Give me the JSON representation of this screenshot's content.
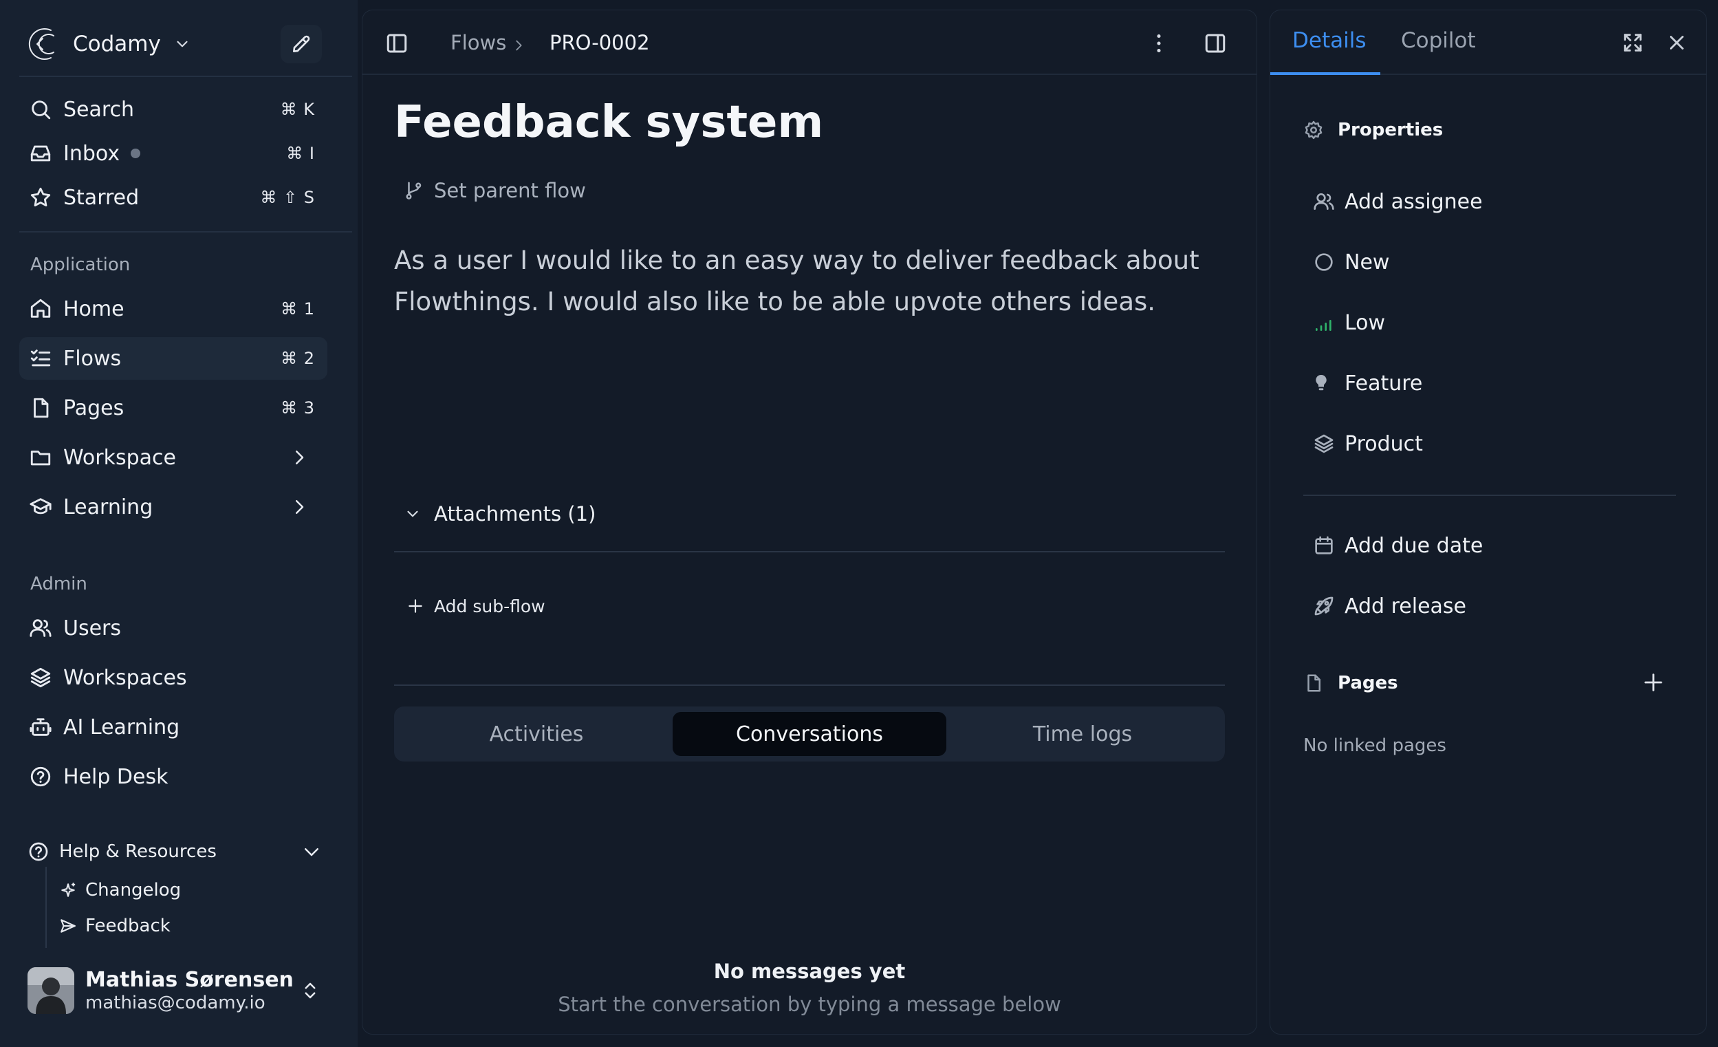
{
  "workspace": {
    "name": "Codamy"
  },
  "quick_nav": [
    {
      "label": "Search",
      "shortcut": "⌘ K",
      "icon": "search-icon"
    },
    {
      "label": "Inbox",
      "shortcut": "⌘ I",
      "icon": "inbox-icon"
    },
    {
      "label": "Starred",
      "shortcut": "⌘ ⇧ S",
      "icon": "star-icon"
    }
  ],
  "application": {
    "heading": "Application",
    "items": [
      {
        "label": "Home",
        "shortcut": "⌘ 1",
        "icon": "home-icon"
      },
      {
        "label": "Flows",
        "shortcut": "⌘ 2",
        "icon": "list-checks-icon",
        "active": true
      },
      {
        "label": "Pages",
        "shortcut": "⌘ 3",
        "icon": "file-icon"
      },
      {
        "label": "Workspace",
        "icon": "folder-icon"
      },
      {
        "label": "Learning",
        "icon": "graduation-cap-icon"
      }
    ]
  },
  "admin": {
    "heading": "Admin",
    "items": [
      {
        "label": "Users",
        "icon": "users-icon"
      },
      {
        "label": "Workspaces",
        "icon": "layers-icon"
      },
      {
        "label": "AI Learning",
        "icon": "bot-icon"
      },
      {
        "label": "Help Desk",
        "icon": "help-circle-icon"
      }
    ]
  },
  "help": {
    "label": "Help & Resources",
    "items": [
      {
        "label": "Changelog",
        "icon": "sparkles-icon"
      },
      {
        "label": "Feedback",
        "icon": "send-icon"
      }
    ]
  },
  "user": {
    "name": "Mathias Sørensen",
    "email": "mathias@codamy.io"
  },
  "breadcrumb": {
    "parent": "Flows",
    "current": "PRO-0002"
  },
  "flow": {
    "title": "Feedback system",
    "set_parent_label": "Set parent flow",
    "description": "As a user I would like to an easy way to deliver feedback about Flowthings. I would also like to be able upvote others ideas.",
    "attachments_label": "Attachments (1)",
    "add_subflow_label": "Add sub-flow"
  },
  "tabs": [
    {
      "label": "Activities",
      "active": false
    },
    {
      "label": "Conversations",
      "active": true
    },
    {
      "label": "Time logs",
      "active": false
    }
  ],
  "conversation": {
    "empty_title": "No messages yet",
    "empty_subtitle": "Start the conversation by typing a message below"
  },
  "panel": {
    "tabs": [
      {
        "label": "Details",
        "active": true
      },
      {
        "label": "Copilot",
        "active": false
      }
    ],
    "properties_heading": "Properties",
    "properties": [
      {
        "label": "Add assignee",
        "icon": "users-icon"
      },
      {
        "label": "New",
        "icon": "circle-icon"
      },
      {
        "label": "Low",
        "icon": "signal-low-icon"
      },
      {
        "label": "Feature",
        "icon": "lightbulb-icon"
      },
      {
        "label": "Product",
        "icon": "layers-icon"
      }
    ],
    "dates": [
      {
        "label": "Add due date",
        "icon": "calendar-icon"
      },
      {
        "label": "Add release",
        "icon": "rocket-icon"
      }
    ],
    "pages_heading": "Pages",
    "no_pages": "No linked pages"
  },
  "colors": {
    "accent": "#3d8ef0",
    "background": "#121a27",
    "sidebar": "#172130",
    "priority_low": "#2fb36a"
  }
}
